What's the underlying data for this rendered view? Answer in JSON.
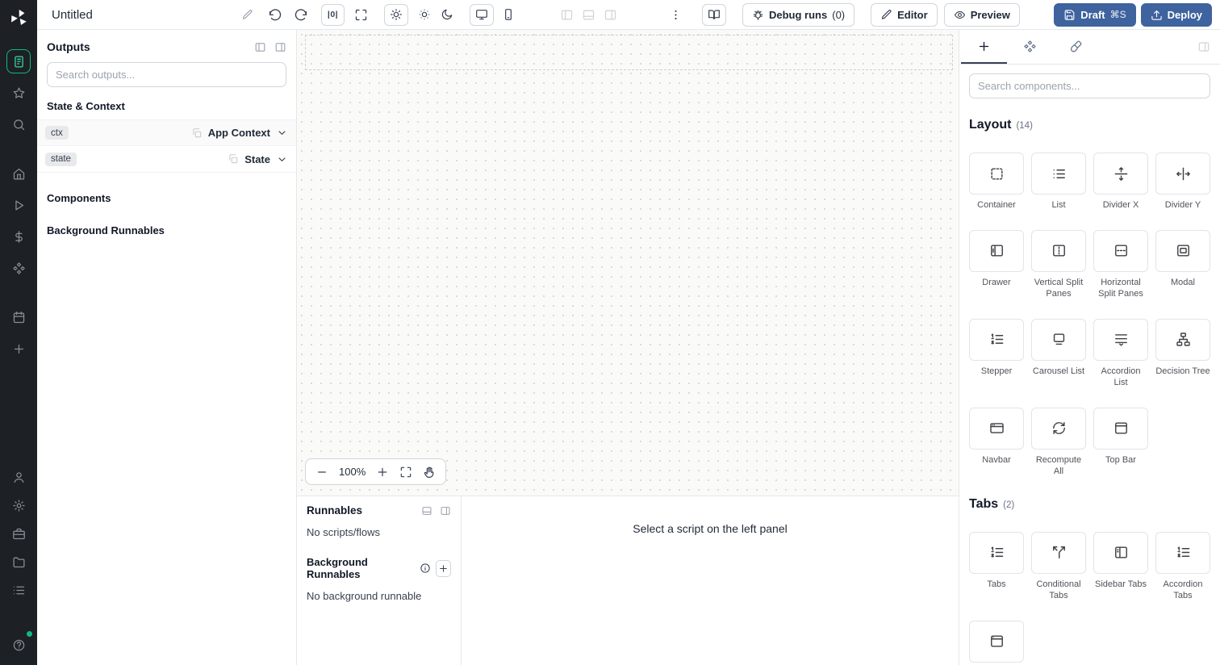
{
  "colors": {
    "accent_green": "#10b981",
    "primary_blue": "#3e639e",
    "sidebar_bg": "#1d2025"
  },
  "topbar": {
    "title": "Untitled",
    "zoom_reset": "|0|",
    "debug_runs": "Debug runs",
    "debug_count": "(0)",
    "editor": "Editor",
    "preview": "Preview",
    "draft": "Draft",
    "draft_shortcut": "⌘S",
    "deploy": "Deploy"
  },
  "sidebar": {
    "top": [
      {
        "name": "app-editor",
        "icon": "app-editor-icon",
        "active": true
      },
      {
        "name": "favorites",
        "icon": "star-icon"
      },
      {
        "name": "search",
        "icon": "search-icon"
      },
      {
        "name": "home",
        "icon": "home-icon",
        "gap": true
      },
      {
        "name": "runs",
        "icon": "play-icon"
      },
      {
        "name": "variables",
        "icon": "dollar-icon"
      },
      {
        "name": "resources",
        "icon": "components-icon"
      },
      {
        "name": "schedules",
        "icon": "calendar-icon",
        "gap": true
      },
      {
        "name": "create",
        "icon": "plus-icon"
      }
    ],
    "bottom": [
      {
        "name": "user",
        "icon": "user-icon"
      },
      {
        "name": "settings",
        "icon": "gear-icon"
      },
      {
        "name": "workers",
        "icon": "toolbox-icon"
      },
      {
        "name": "folders",
        "icon": "folder-icon"
      },
      {
        "name": "logs",
        "icon": "list-icon"
      },
      {
        "name": "help",
        "icon": "help-icon",
        "gap": true,
        "dot": true
      }
    ]
  },
  "outputs_panel": {
    "title": "Outputs",
    "search_placeholder": "Search outputs...",
    "state_context_title": "State & Context",
    "rows": [
      {
        "badge": "ctx",
        "type": "App Context"
      },
      {
        "badge": "state",
        "type": "State"
      }
    ],
    "components_title": "Components",
    "background_title": "Background Runnables"
  },
  "canvas": {
    "zoom": "100%"
  },
  "runnables_panel": {
    "title": "Runnables",
    "empty_scripts": "No scripts/flows",
    "background_title": "Background Runnables",
    "empty_background": "No background runnable"
  },
  "script_panel": {
    "placeholder": "Select a script on the left panel"
  },
  "components_panel": {
    "search_placeholder": "Search components...",
    "tabs": [
      {
        "name": "insert",
        "icon": "plus-icon",
        "active": true
      },
      {
        "name": "components-tree",
        "icon": "component-icon"
      },
      {
        "name": "styling",
        "icon": "brush-icon"
      }
    ],
    "sections": [
      {
        "title": "Layout",
        "count": "(14)",
        "items": [
          {
            "label": "Container",
            "icon": "container-icon"
          },
          {
            "label": "List",
            "icon": "list-lines-icon"
          },
          {
            "label": "Divider X",
            "icon": "divider-x-icon"
          },
          {
            "label": "Divider Y",
            "icon": "divider-y-icon"
          },
          {
            "label": "Drawer",
            "icon": "drawer-icon"
          },
          {
            "label": "Vertical Split Panes",
            "icon": "vertical-split-icon"
          },
          {
            "label": "Horizontal Split Panes",
            "icon": "horizontal-split-icon"
          },
          {
            "label": "Modal",
            "icon": "modal-icon"
          },
          {
            "label": "Stepper",
            "icon": "stepper-icon"
          },
          {
            "label": "Carousel List",
            "icon": "carousel-icon"
          },
          {
            "label": "Accordion List",
            "icon": "accordion-list-icon"
          },
          {
            "label": "Decision Tree",
            "icon": "decision-tree-icon"
          },
          {
            "label": "Navbar",
            "icon": "navbar-icon"
          },
          {
            "label": "Recompute All",
            "icon": "recompute-icon"
          },
          {
            "label": "Top Bar",
            "icon": "top-bar-icon"
          }
        ]
      },
      {
        "title": "Tabs",
        "count": "(2)",
        "items": [
          {
            "label": "Tabs",
            "icon": "tabs-icon"
          },
          {
            "label": "Conditional Tabs",
            "icon": "conditional-tabs-icon"
          },
          {
            "label": "Sidebar Tabs",
            "icon": "sidebar-tabs-icon"
          },
          {
            "label": "Accordion Tabs",
            "icon": "accordion-tabs-icon"
          },
          {
            "label": "",
            "icon": "window-icon",
            "partial": true
          }
        ]
      }
    ]
  }
}
